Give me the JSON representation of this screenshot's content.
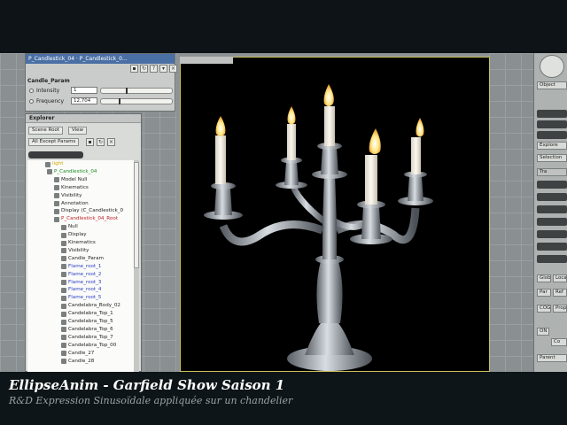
{
  "property_panel": {
    "title": "P_Candlestick_04 · P_Candlestick_0...",
    "section": "Candle_Param",
    "params": [
      {
        "label": "Intensity",
        "value": "1",
        "fraction": 0.35
      },
      {
        "label": "Frequency",
        "value": "12,704",
        "fraction": 0.25
      }
    ]
  },
  "explorer": {
    "title": "Explorer",
    "scene_root_button": "Scene Root",
    "view_button": "View",
    "filter_button": "All Except Params",
    "tree": [
      {
        "label": "light",
        "color": "#c9a800"
      },
      {
        "label": "P_Candlestick_04",
        "color": "#1a8a1a"
      },
      {
        "label": "Model Null",
        "color": "#222222"
      },
      {
        "label": "Kinematics",
        "color": "#222222"
      },
      {
        "label": "Visibility",
        "color": "#222222"
      },
      {
        "label": "Annotation",
        "color": "#222222"
      },
      {
        "label": "Display (C_Candlestick_0",
        "color": "#222222"
      },
      {
        "label": "P_Candlestick_04_Root",
        "color": "#c02020"
      },
      {
        "label": "Null",
        "color": "#222222"
      },
      {
        "label": "Display",
        "color": "#222222"
      },
      {
        "label": "Kinematics",
        "color": "#222222"
      },
      {
        "label": "Visibility",
        "color": "#222222"
      },
      {
        "label": "Candle_Param",
        "color": "#222222"
      },
      {
        "label": "Flame_root_1",
        "color": "#2a3fc0"
      },
      {
        "label": "Flame_root_2",
        "color": "#2a3fc0"
      },
      {
        "label": "Flame_root_3",
        "color": "#2a3fc0"
      },
      {
        "label": "Flame_root_4",
        "color": "#2a3fc0"
      },
      {
        "label": "Flame_root_5",
        "color": "#2a3fc0"
      },
      {
        "label": "Candelabra_Body_02",
        "color": "#222222"
      },
      {
        "label": "Candelabra_Top_1",
        "color": "#222222"
      },
      {
        "label": "Candelabra_Top_5",
        "color": "#222222"
      },
      {
        "label": "Candelabra_Top_6",
        "color": "#222222"
      },
      {
        "label": "Candelabra_Top_7",
        "color": "#222222"
      },
      {
        "label": "Candelabra_Top_00",
        "color": "#222222"
      },
      {
        "label": "Candle_27",
        "color": "#222222"
      },
      {
        "label": "Candle_28",
        "color": "#222222"
      }
    ]
  },
  "right_toolbar": {
    "object_label": "Object",
    "explore_label": "Explore",
    "selection_label": "Selection",
    "transform_label": "Tra",
    "global_label": "Global",
    "local_label": "Loca",
    "par_label": "Par",
    "ref_label": "Ref",
    "cog_label": "COG",
    "prop_label": "Prop",
    "on_label": "ON",
    "co_label": "Co",
    "parent_label": "Parent"
  },
  "caption": {
    "line1": "EllipseAnim - Garfield Show Saison 1",
    "line2": "R&D Expression Sinusoïdale appliquée sur un chandelier"
  },
  "colors": {
    "candle_wax": "#f2ede2",
    "flame": "#fff2b0",
    "metal": "#b8bec4"
  }
}
